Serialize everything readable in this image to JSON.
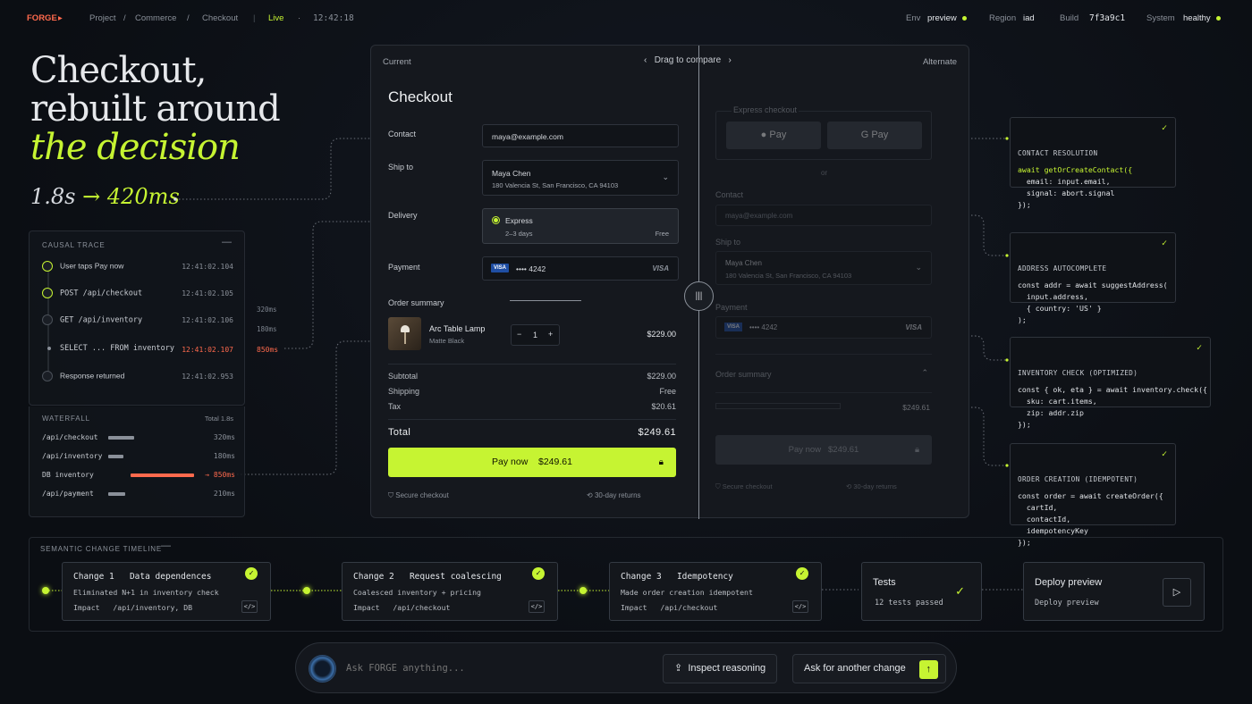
{
  "topbar": {
    "brand": "FORGE",
    "crumbs": [
      "Project",
      "Commerce",
      "Checkout"
    ],
    "separator": "/",
    "status": "Live",
    "time": "12:42:18",
    "env_label": "Env",
    "env_value": "preview",
    "region_label": "Region",
    "region_value": "iad",
    "build_label": "Build",
    "build_value": "7f3a9c1",
    "system_label": "System",
    "system_value": "healthy"
  },
  "hero": {
    "line1": "Checkout,",
    "line2": "rebuilt around",
    "line3": "the decision",
    "metric_from": "1.8s",
    "metric_arrow": "→",
    "metric_to": "420ms"
  },
  "trace": {
    "title": "CAUSAL TRACE",
    "rows": [
      {
        "label": "User taps Pay now",
        "ts": "12:41:02.104"
      },
      {
        "label": "POST  /api/checkout",
        "ts": "12:41:02.105"
      },
      {
        "label": "GET  /api/inventory",
        "ts": "12:41:02.106"
      },
      {
        "label": "SELECT ... FROM inventory",
        "ts": "12:41:02.107",
        "dur": "850ms"
      },
      {
        "label": "Response returned",
        "ts": "12:41:02.953"
      }
    ],
    "side_320": "320ms",
    "side_180": "180ms"
  },
  "waterfall": {
    "title": "WATERFALL",
    "total": "Total 1.8s",
    "rows": [
      {
        "label": "/api/checkout",
        "value": "320ms",
        "fraction": 0.178
      },
      {
        "label": "/api/inventory",
        "value": "180ms",
        "fraction": 0.1
      },
      {
        "label": "DB  inventory",
        "value": "850ms",
        "fraction": 0.472
      },
      {
        "label": "/api/payment",
        "value": "210ms",
        "fraction": 0.117
      }
    ],
    "arrow": "→"
  },
  "compare": {
    "current": "Current",
    "drag": "Drag to compare",
    "alternate": "Alternate"
  },
  "checkout": {
    "title": "Checkout",
    "contact_label": "Contact",
    "contact_value": "maya@example.com",
    "ship_label": "Ship to",
    "ship_name": "Maya Chen",
    "ship_address": "180 Valencia St, San Francisco, CA 94103",
    "delivery_label": "Delivery",
    "delivery_option": "Express",
    "delivery_days": "2–3 days",
    "delivery_price": "Free",
    "payment_label": "Payment",
    "card_brand_badge": "VISA",
    "card_number": "•••• 4242",
    "card_brand": "VISA",
    "order_summary": "Order summary",
    "item_name": "Arc Table Lamp",
    "item_variant": "Matte Black",
    "item_qty": "1",
    "item_minus": "−",
    "item_plus": "+",
    "item_price": "$229.00",
    "subtotal_label": "Subtotal",
    "subtotal": "$229.00",
    "shipping_label": "Shipping",
    "shipping": "Free",
    "tax_label": "Tax",
    "tax": "$20.61",
    "total_label": "Total",
    "total": "$249.61",
    "pay_label": "Pay now",
    "pay_amount": "$249.61",
    "secure": "Secure checkout",
    "returns": "30-day returns"
  },
  "alt": {
    "express_label": "Express checkout",
    "apple_pay": "Pay",
    "google_pay": "G Pay",
    "or": "or",
    "contact_label": "Contact",
    "contact_placeholder": "maya@example.com",
    "ship_label": "Ship to",
    "ship_name": "Maya Chen",
    "ship_address": "180 Valencia St, San Francisco, CA 94103",
    "payment_label": "Payment",
    "card_badge": "VISA",
    "card_number": "•••• 4242",
    "card_brand": "VISA",
    "order_summary": "Order summary",
    "total": "$249.61",
    "pay_label": "Pay now",
    "pay_amount": "$249.61",
    "secure": "Secure checkout",
    "returns": "30-day returns"
  },
  "cards": [
    {
      "title": "CONTACT RESOLUTION",
      "lines": [
        "await getOrCreateContact({",
        "  email: input.email,",
        "  signal: abort.signal",
        "});"
      ]
    },
    {
      "title": "ADDRESS AUTOCOMPLETE",
      "lines": [
        "const addr = await suggestAddress(",
        "  input.address,",
        "  { country: 'US' }",
        ");"
      ]
    },
    {
      "title": "INVENTORY CHECK (OPTIMIZED)",
      "lines": [
        "const { ok, eta } = await inventory.check({",
        "  sku: cart.items,",
        "  zip: addr.zip",
        "});"
      ]
    },
    {
      "title": "ORDER CREATION (IDEMPOTENT)",
      "lines": [
        "const order = await createOrder({",
        "  cartId,",
        "  contactId,",
        "  idempotencyKey",
        "});"
      ]
    }
  ],
  "timeline": {
    "title": "SEMANTIC CHANGE TIMELINE",
    "changes": [
      {
        "num": "Change 1",
        "name": "Data dependences",
        "desc": "Eliminated N+1 in inventory check",
        "impact_label": "Impact",
        "impact": "/api/inventory, DB"
      },
      {
        "num": "Change 2",
        "name": "Request coalescing",
        "desc": "Coalesced inventory + pricing",
        "impact_label": "Impact",
        "impact": "/api/checkout"
      },
      {
        "num": "Change 3",
        "name": "Idempotency",
        "desc": "Made order creation idempotent",
        "impact_label": "Impact",
        "impact": "/api/checkout"
      }
    ],
    "tests_title": "Tests",
    "tests_sub": "12 tests passed",
    "deploy_title": "Deploy preview",
    "deploy_sub": "Deploy preview"
  },
  "ask": {
    "placeholder": "Ask FORGE anything...",
    "inspect": "Inspect reasoning",
    "another": "Ask for another change"
  },
  "colors": {
    "accent": "#c6f432",
    "danger": "#ff6a4d",
    "bg": "#0c0f14"
  }
}
